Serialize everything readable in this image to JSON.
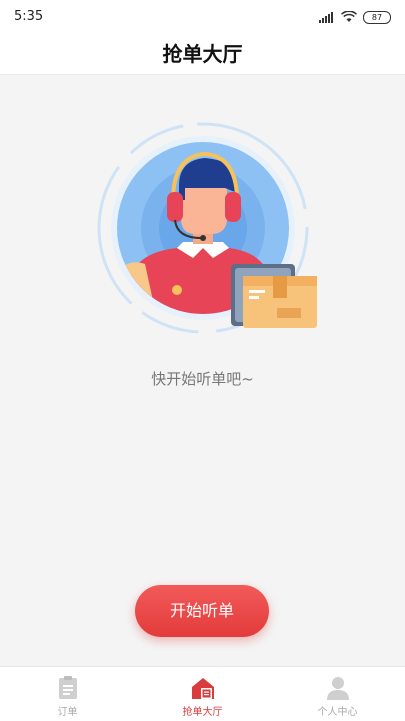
{
  "status_bar": {
    "time": "5:35",
    "battery": "87",
    "icons": [
      "signal-icon",
      "wifi-icon",
      "battery-icon"
    ]
  },
  "header": {
    "title": "抢单大厅"
  },
  "main": {
    "illustration": "customer-service-agent-with-package",
    "empty_text": "快开始听单吧~",
    "start_button_label": "开始听单"
  },
  "tabbar": {
    "items": [
      {
        "label": "订单",
        "icon": "clipboard-icon",
        "active": false
      },
      {
        "label": "抢单大厅",
        "icon": "store-icon",
        "active": true
      },
      {
        "label": "个人中心",
        "icon": "person-icon",
        "active": false
      }
    ]
  },
  "colors": {
    "accent": "#e33b3b",
    "tab_active": "#d83c3c",
    "tab_inactive": "#aaaaaa",
    "background": "#f4f4f4"
  }
}
